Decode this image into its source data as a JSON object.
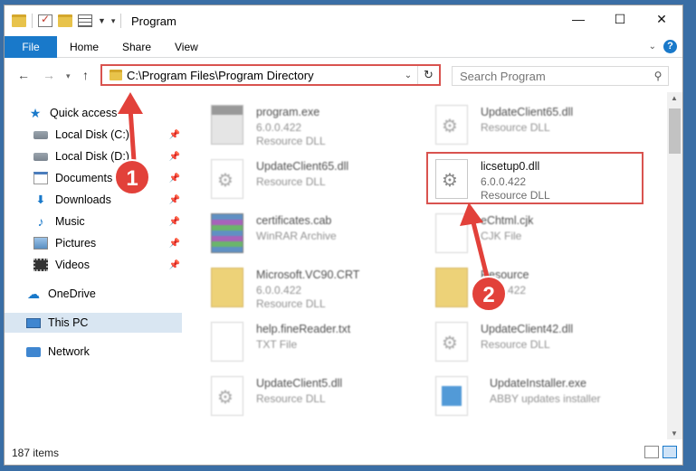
{
  "window": {
    "title": "Program",
    "controls": {
      "minimize": "—",
      "maximize": "☐",
      "close": "✕"
    }
  },
  "ribbon": {
    "tabs": [
      "File",
      "Home",
      "Share",
      "View"
    ],
    "expand_icon": "chevron-down-icon",
    "help": "?"
  },
  "nav": {
    "back": "←",
    "forward": "→",
    "recent": "▾",
    "up": "↑",
    "address": "C:\\Program Files\\Program Directory",
    "refresh": "↻",
    "search_placeholder": "Search Program"
  },
  "sidebar": {
    "items": [
      {
        "label": "Quick access",
        "icon": "star-icon"
      },
      {
        "label": "Local Disk (C:)",
        "icon": "disk-icon",
        "pinned": true
      },
      {
        "label": "Local Disk (D:)",
        "icon": "disk-icon",
        "pinned": true
      },
      {
        "label": "Documents",
        "icon": "documents-icon",
        "pinned": true
      },
      {
        "label": "Downloads",
        "icon": "download-icon",
        "pinned": true
      },
      {
        "label": "Music",
        "icon": "music-icon",
        "pinned": true
      },
      {
        "label": "Pictures",
        "icon": "pictures-icon",
        "pinned": true
      },
      {
        "label": "Videos",
        "icon": "videos-icon",
        "pinned": true
      },
      {
        "label": "OneDrive",
        "icon": "cloud-icon"
      },
      {
        "label": "This PC",
        "icon": "computer-icon",
        "selected": true
      },
      {
        "label": "Network",
        "icon": "network-icon"
      }
    ]
  },
  "files": [
    {
      "name": "program.exe",
      "line1": "6.0.0.422",
      "line2": "Resource DLL",
      "icon": "exe-icon"
    },
    {
      "name": "UpdateClient65.dll",
      "line1": "Resource DLL",
      "line2": "",
      "icon": "dll-icon"
    },
    {
      "name": "UpdateClient65.dll",
      "line1": "Resource DLL",
      "line2": "",
      "icon": "dll-icon"
    },
    {
      "name": "licsetup0.dll",
      "line1": "6.0.0.422",
      "line2": "Resource DLL",
      "icon": "dll-icon"
    },
    {
      "name": "certificates.cab",
      "line1": "WinRAR Archive",
      "line2": "",
      "icon": "archive-icon"
    },
    {
      "name": "eChtml.cjk",
      "line1": "CJK File",
      "line2": "",
      "icon": "blank-file-icon"
    },
    {
      "name": "Microsoft.VC90.CRT",
      "line1": "6.0.0.422",
      "line2": "Resource DLL",
      "icon": "folder-icon"
    },
    {
      "name": "Resource",
      "line1": "6.0.0.422",
      "line2": "",
      "icon": "folder-icon"
    },
    {
      "name": "help.fineReader.txt",
      "line1": "TXT File",
      "line2": "",
      "icon": "blank-file-icon"
    },
    {
      "name": "UpdateClient42.dll",
      "line1": "Resource DLL",
      "line2": "",
      "icon": "dll-icon"
    },
    {
      "name": "UpdateClient5.dll",
      "line1": "Resource DLL",
      "line2": "",
      "icon": "dll-icon"
    },
    {
      "name": "UpdateInstaller.exe",
      "line1": "ABBY updates installer",
      "line2": "",
      "icon": "installer-icon"
    }
  ],
  "status": {
    "count": "187 items"
  },
  "annotations": {
    "badge1": "1",
    "badge2": "2",
    "color": "#e2413a"
  }
}
